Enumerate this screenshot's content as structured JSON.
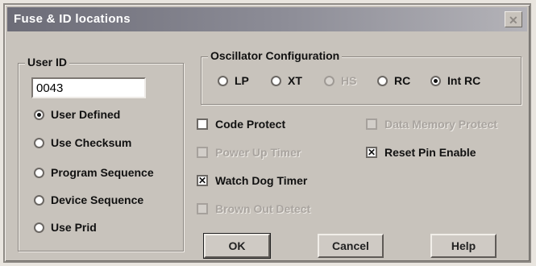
{
  "window": {
    "title": "Fuse & ID locations",
    "close_label": "✕"
  },
  "user_id": {
    "label": "User ID",
    "value": "0043",
    "options": [
      {
        "label": "User Defined",
        "selected": true
      },
      {
        "label": "Use Checksum",
        "selected": false
      },
      {
        "label": "Program Sequence",
        "selected": false
      },
      {
        "label": "Device Sequence",
        "selected": false
      },
      {
        "label": "Use Prid",
        "selected": false
      }
    ]
  },
  "oscillator": {
    "label": "Oscillator Configuration",
    "options": [
      {
        "label": "LP",
        "selected": false,
        "enabled": true
      },
      {
        "label": "XT",
        "selected": false,
        "enabled": true
      },
      {
        "label": "HS",
        "selected": false,
        "enabled": false
      },
      {
        "label": "RC",
        "selected": false,
        "enabled": true
      },
      {
        "label": "Int RC",
        "selected": true,
        "enabled": true
      }
    ]
  },
  "options": {
    "code_protect": {
      "label": "Code Protect",
      "checked": false,
      "enabled": true
    },
    "data_memory_protect": {
      "label": "Data Memory Protect",
      "checked": false,
      "enabled": false
    },
    "power_up_timer": {
      "label": "Power Up Timer",
      "checked": false,
      "enabled": false
    },
    "reset_pin_enable": {
      "label": "Reset Pin Enable",
      "checked": true,
      "enabled": true
    },
    "watch_dog_timer": {
      "label": "Watch Dog Timer",
      "checked": true,
      "enabled": true
    },
    "brown_out_detect": {
      "label": "Brown Out Detect",
      "checked": false,
      "enabled": false
    }
  },
  "buttons": {
    "ok": "OK",
    "cancel": "Cancel",
    "help": "Help"
  }
}
